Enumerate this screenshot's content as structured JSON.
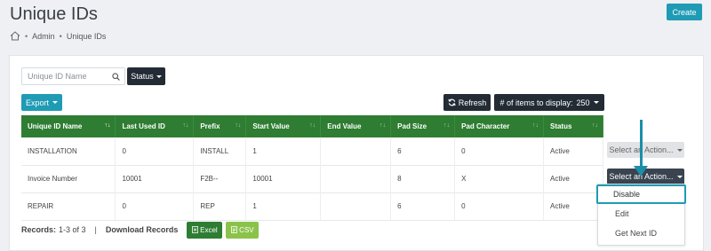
{
  "page": {
    "title": "Unique IDs",
    "create_label": "Create"
  },
  "breadcrumb": {
    "items": [
      "Admin",
      "Unique IDs"
    ]
  },
  "filters": {
    "search_placeholder": "Unique ID Name",
    "status_label": "Status"
  },
  "toolbar": {
    "export_label": "Export",
    "refresh_label": "Refresh",
    "items_label": "# of items to display:",
    "items_value": "250"
  },
  "table": {
    "columns": [
      "Unique ID Name",
      "Last Used ID",
      "Prefix",
      "Start Value",
      "End Value",
      "Pad Size",
      "Pad Character",
      "Status"
    ],
    "rows": [
      [
        "INSTALLATION",
        "0",
        "INSTALL",
        "1",
        "",
        "6",
        "0",
        "Active"
      ],
      [
        "Invoice Number",
        "10001",
        "F2B--",
        "10001",
        "",
        "8",
        "X",
        "Active"
      ],
      [
        "REPAIR",
        "0",
        "REP",
        "1",
        "",
        "6",
        "0",
        "Active"
      ]
    ]
  },
  "actions": {
    "select_label": "Select an Action..."
  },
  "dropdown": {
    "items": [
      "Disable",
      "Edit",
      "Get Next ID"
    ]
  },
  "footer": {
    "records_label": "Records:",
    "records_value": "1-3 of 3",
    "separator": "|",
    "download_label": "Download Records",
    "excel_label": "Excel",
    "csv_label": "CSV"
  },
  "colors": {
    "accent": "#1f9bb5",
    "dark_button": "#232c35",
    "table_header": "#2e7d32",
    "excel": "#2e7d32",
    "csv": "#8bc34a"
  }
}
